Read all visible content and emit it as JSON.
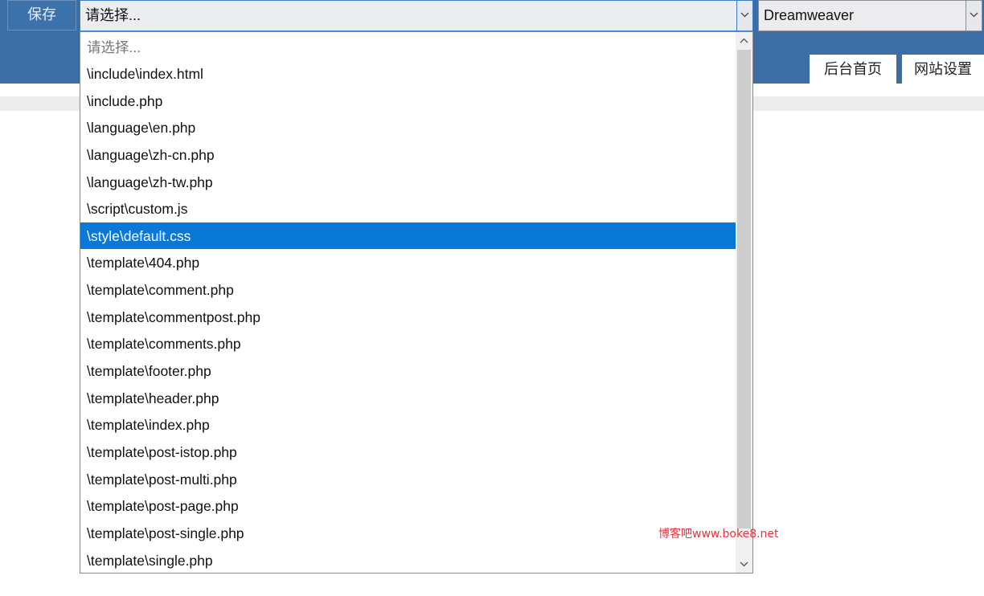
{
  "toolbar": {
    "save_label": "保存"
  },
  "file_select": {
    "value": "请选择...",
    "arrow_icon": "chevron-down-icon"
  },
  "editor_select": {
    "value": "Dreamweaver",
    "arrow_icon": "chevron-down-icon"
  },
  "nav_tabs": [
    {
      "label": "后台首页"
    },
    {
      "label": "网站设置"
    }
  ],
  "dropdown": {
    "options": [
      {
        "label": "请选择..."
      },
      {
        "label": "\\include\\index.html"
      },
      {
        "label": "\\include.php"
      },
      {
        "label": "\\language\\en.php"
      },
      {
        "label": "\\language\\zh-cn.php"
      },
      {
        "label": "\\language\\zh-tw.php"
      },
      {
        "label": "\\script\\custom.js"
      },
      {
        "label": "\\style\\default.css"
      },
      {
        "label": "\\template\\404.php"
      },
      {
        "label": "\\template\\comment.php"
      },
      {
        "label": "\\template\\commentpost.php"
      },
      {
        "label": "\\template\\comments.php"
      },
      {
        "label": "\\template\\footer.php"
      },
      {
        "label": "\\template\\header.php"
      },
      {
        "label": "\\template\\index.php"
      },
      {
        "label": "\\template\\post-istop.php"
      },
      {
        "label": "\\template\\post-multi.php"
      },
      {
        "label": "\\template\\post-page.php"
      },
      {
        "label": "\\template\\post-single.php"
      },
      {
        "label": "\\template\\single.php"
      }
    ],
    "selected_label": "\\style\\default.css",
    "scroll_up_icon": "chevron-up-icon",
    "scroll_down_icon": "chevron-down-icon"
  },
  "watermark": "博客吧www.boke8.net",
  "colors": {
    "header_blue": "#3c6ea5",
    "selection_blue": "#0a78d7",
    "watermark_red": "#e8333a"
  }
}
